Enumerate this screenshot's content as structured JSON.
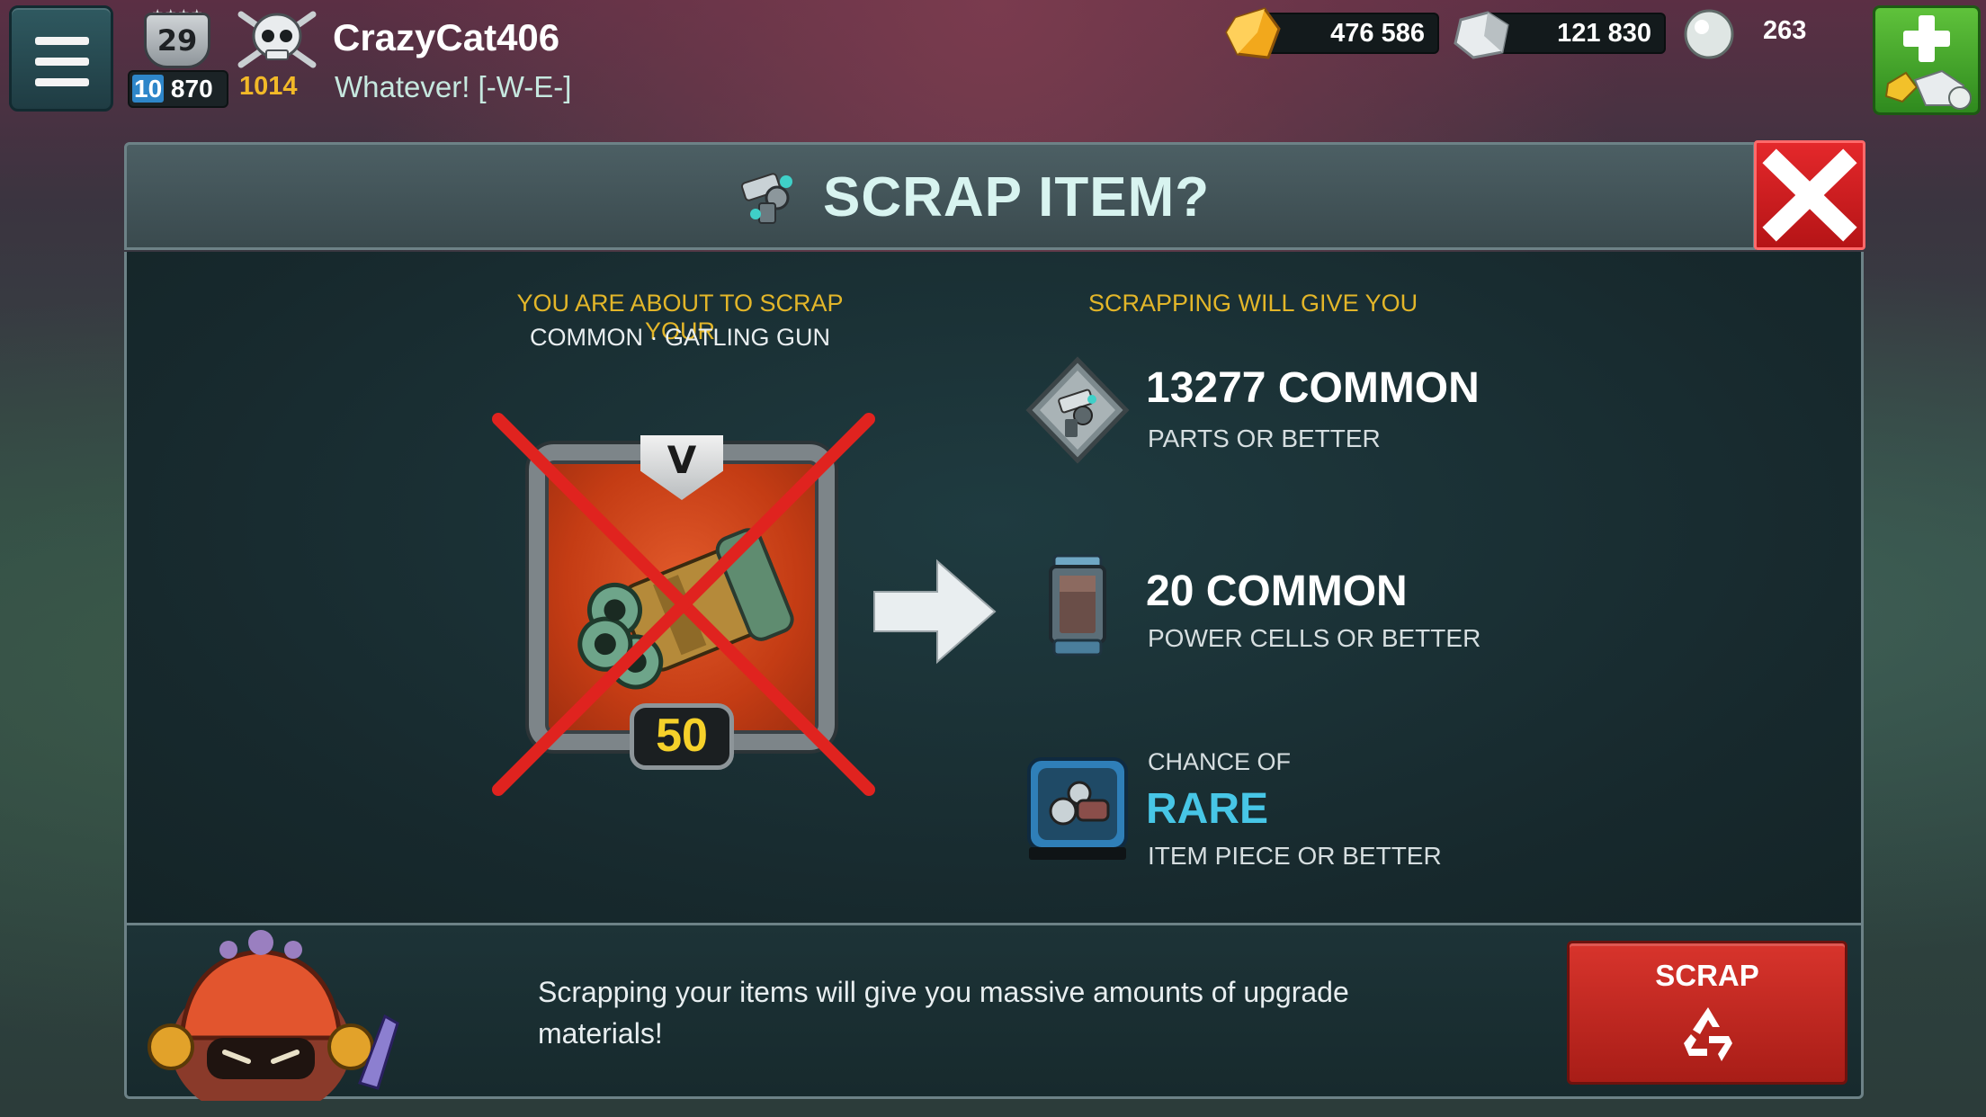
{
  "player": {
    "rank": "29",
    "trophies_highlight": "10",
    "trophies_rest": " 870",
    "skull_score": "1014",
    "name": "CrazyCat406",
    "clan": "Whatever! [-W-E-]"
  },
  "resources": {
    "gold": "476 586",
    "silver": "121 830",
    "pearls": "263"
  },
  "dialog": {
    "title": "SCRAP ITEM?",
    "scrap_heading": "YOU ARE ABOUT TO SCRAP YOUR",
    "scrap_item": "COMMON · GATLING GUN",
    "give_heading": "SCRAPPING WILL GIVE YOU",
    "item_level": "50",
    "item_rank": "V",
    "rewards": [
      {
        "amount": "13277 COMMON",
        "desc": "PARTS OR BETTER",
        "icon": "parts-icon"
      },
      {
        "amount": "20 COMMON",
        "desc": "POWER CELLS OR BETTER",
        "icon": "power-cell-icon"
      },
      {
        "chance": "CHANCE OF",
        "rarity": "RARE",
        "desc": "ITEM PIECE OR BETTER",
        "icon": "item-piece-icon"
      }
    ],
    "footer_text": "Scrapping your items will give you massive amounts of upgrade materials!",
    "scrap_button": "SCRAP"
  },
  "colors": {
    "accent_yellow": "#e3b629",
    "rare_blue": "#47c6e6",
    "danger_red": "#d8342c",
    "store_green": "#5fc23b"
  }
}
